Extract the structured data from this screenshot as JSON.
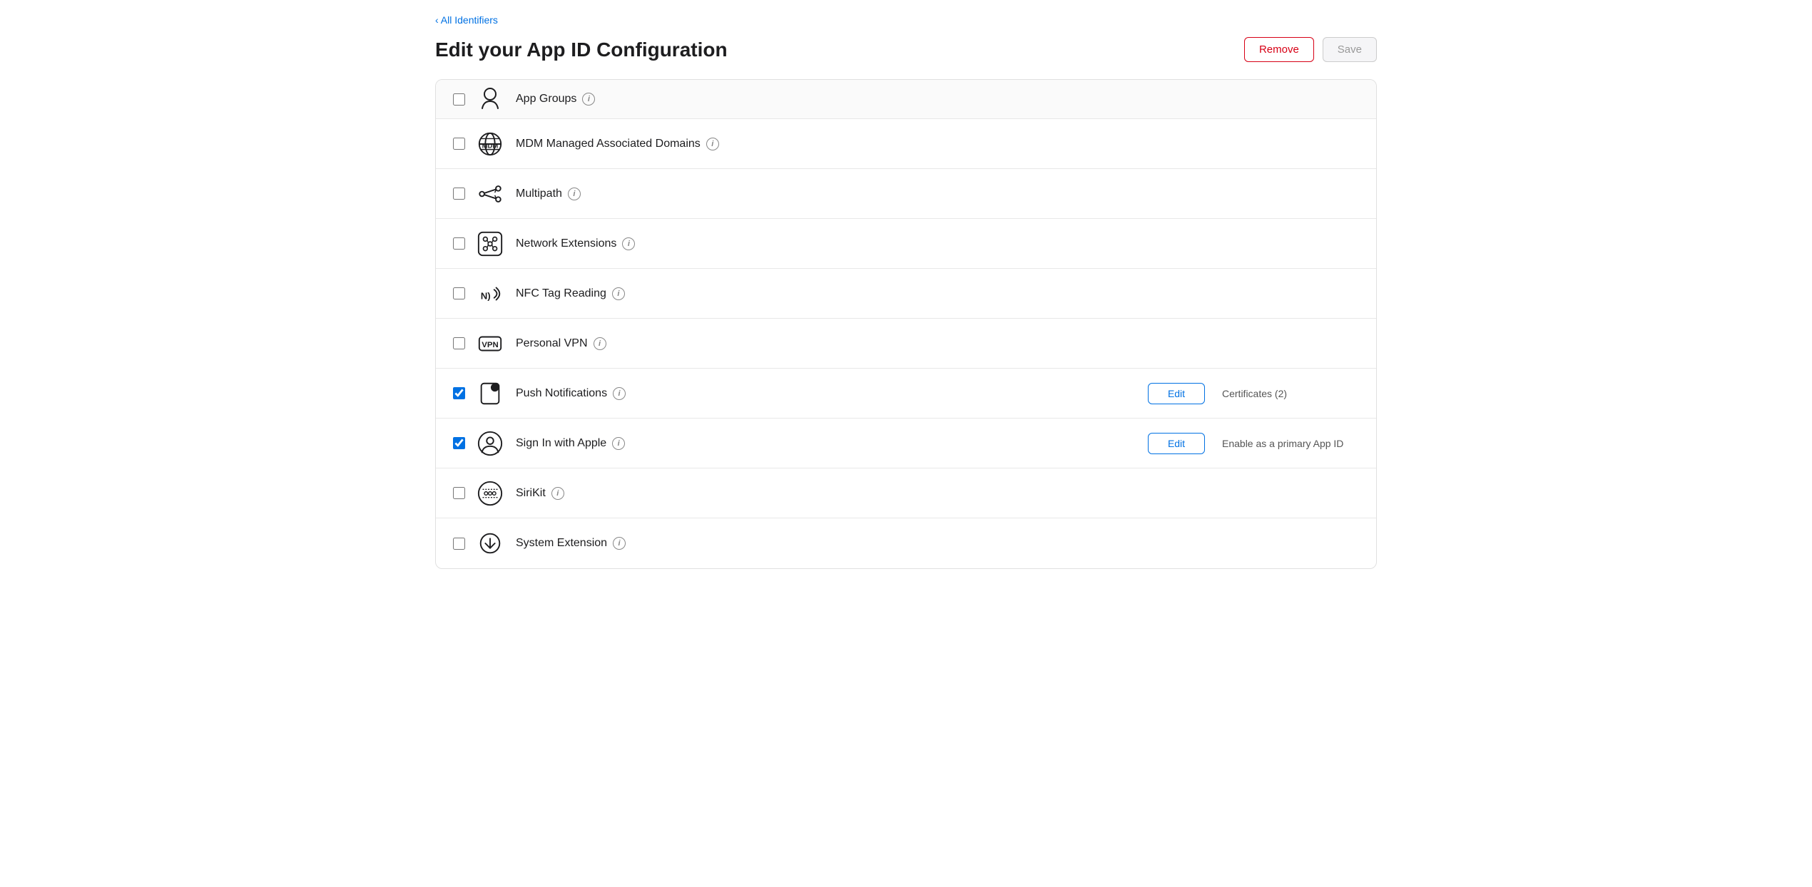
{
  "nav": {
    "back_label": "‹ All Identifiers"
  },
  "header": {
    "title": "Edit your App ID Configuration",
    "remove_label": "Remove",
    "save_label": "Save"
  },
  "capabilities": [
    {
      "id": "partial-top",
      "name": "",
      "checked": false,
      "partial": true,
      "has_edit": false,
      "status": ""
    },
    {
      "id": "mdm-managed",
      "name": "MDM Managed Associated Domains",
      "checked": false,
      "has_edit": false,
      "status": "",
      "icon": "mdm"
    },
    {
      "id": "multipath",
      "name": "Multipath",
      "checked": false,
      "has_edit": false,
      "status": "",
      "icon": "multipath"
    },
    {
      "id": "network-extensions",
      "name": "Network Extensions",
      "checked": false,
      "has_edit": false,
      "status": "",
      "icon": "network-extensions"
    },
    {
      "id": "nfc-tag-reading",
      "name": "NFC Tag Reading",
      "checked": false,
      "has_edit": false,
      "status": "",
      "icon": "nfc"
    },
    {
      "id": "personal-vpn",
      "name": "Personal VPN",
      "checked": false,
      "has_edit": false,
      "status": "",
      "icon": "vpn"
    },
    {
      "id": "push-notifications",
      "name": "Push Notifications",
      "checked": true,
      "has_edit": true,
      "status": "Certificates (2)",
      "icon": "push-notifications",
      "edit_label": "Edit"
    },
    {
      "id": "sign-in-apple",
      "name": "Sign In with Apple",
      "checked": true,
      "has_edit": true,
      "status": "Enable as a primary App ID",
      "icon": "sign-in-apple",
      "edit_label": "Edit"
    },
    {
      "id": "sirikit",
      "name": "SiriKit",
      "checked": false,
      "has_edit": false,
      "status": "",
      "icon": "sirikit"
    },
    {
      "id": "system-extension",
      "name": "System Extension",
      "checked": false,
      "has_edit": false,
      "status": "",
      "icon": "system-extension"
    }
  ]
}
